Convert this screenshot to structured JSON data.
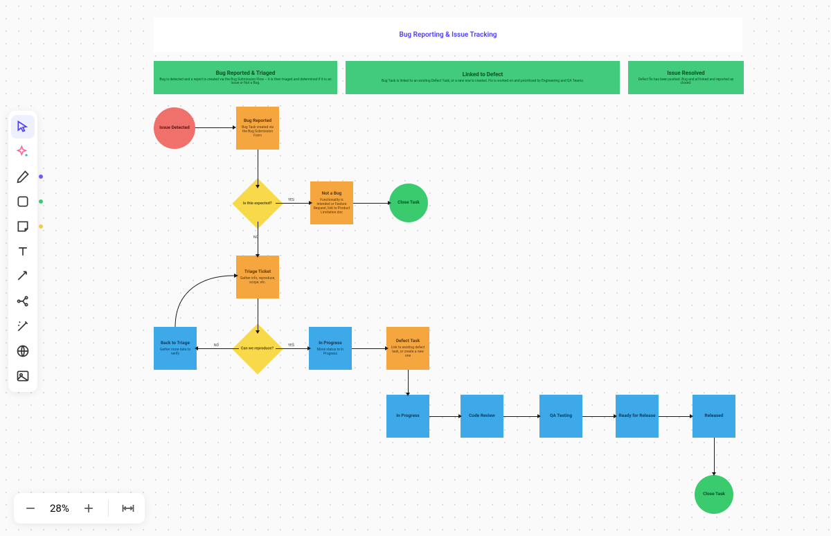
{
  "title": "Bug Reporting & Issue Tracking",
  "stages": {
    "reported": {
      "title": "Bug Reported & Triaged",
      "sub": "Bug is detected and a report is created via the Bug Submission Flow – it is then triaged and determined if it is an issue or Not a Bug."
    },
    "linked": {
      "title": "Linked to Defect",
      "sub": "Bug Task is linked to an existing Defect Task, or a new one is created. Fix is worked on and prioritised by Engineering and QA Teams."
    },
    "resolved": {
      "title": "Issue Resolved",
      "sub": "Defect fix has been pushed. Bug and all linked and reported as closed."
    }
  },
  "nodes": {
    "issue_detected": {
      "title": "Issue Detected"
    },
    "bug_reported": {
      "title": "Bug Reported",
      "sub": "Bug Task created via the Bug Submission Form"
    },
    "is_expected": {
      "title": "Is this expected?"
    },
    "not_a_bug": {
      "title": "Not a Bug",
      "sub": "Functionality is intended or Feature Request, link to Product Limitation doc"
    },
    "close_task_1": {
      "title": "Close Task"
    },
    "triage_ticket": {
      "title": "Triage Ticket",
      "sub": "Gather info, reproduce, scope, etc."
    },
    "can_reproduce": {
      "title": "Can we reproduce?"
    },
    "back_to_triage": {
      "title": "Back to Triage",
      "sub": "Gather more data to verify"
    },
    "in_progress_1": {
      "title": "In Progress",
      "sub": "Move status to In Progress"
    },
    "defect_task": {
      "title": "Defect Task",
      "sub": "Link to existing defect task, or create a new one"
    },
    "in_progress_2": {
      "title": "In Progress"
    },
    "code_review": {
      "title": "Code Review"
    },
    "qa_testing": {
      "title": "QA Testing"
    },
    "ready_release": {
      "title": "Ready for Release"
    },
    "released": {
      "title": "Released"
    },
    "close_task_2": {
      "title": "Close Task"
    }
  },
  "edge_labels": {
    "yes1": "YES",
    "no1": "NO",
    "yes2": "YES",
    "no2": "NO"
  },
  "zoom": {
    "level": "28%"
  },
  "colors": {
    "brand": "#4b3cff",
    "green": "#42cb7d",
    "orange": "#f5a63f",
    "blue": "#3ea9e8",
    "yellow": "#f8d94a",
    "red": "#f0716b"
  },
  "tool_dots": {
    "pen": "#6b5bff",
    "shape": "#3acb6f",
    "note": "#f5c94a"
  }
}
